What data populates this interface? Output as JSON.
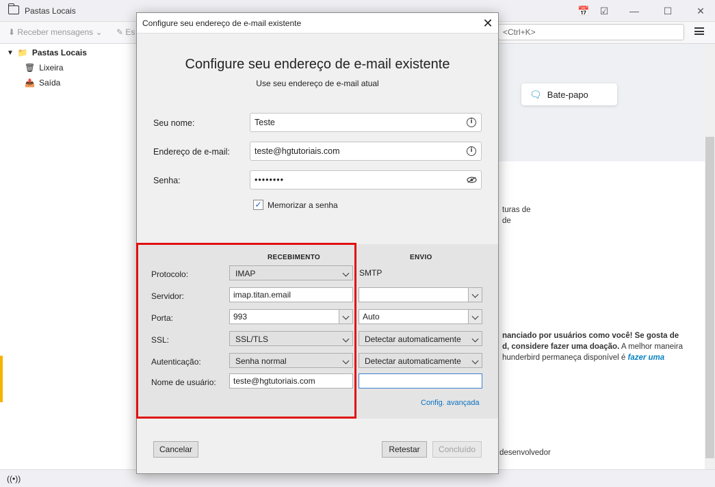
{
  "app": {
    "title": "Pastas Locais",
    "toolbar": {
      "receive_label": "Receber mensagens",
      "write_label": "Es"
    },
    "search_placeholder": "<Ctrl+K>",
    "folders": [
      {
        "label": "Pastas Locais",
        "icon": "folder-icon"
      },
      {
        "label": "Lixeira",
        "icon": "trash-icon"
      },
      {
        "label": "Saída",
        "icon": "outbox-icon"
      }
    ],
    "chat_card_label": "Bate-papo",
    "background_text": {
      "line1": "turas de",
      "line2": "de",
      "donation_bold": "nanciado por usuários como você! Se gosta de",
      "donation_bold2": "d, considere fazer uma doação.",
      "donation_rest": " A melhor maneira",
      "donation_line3": "hunderbird permaneça disponível é ",
      "donation_link": "fazer uma",
      "developer": "desenvolvedor"
    }
  },
  "dialog": {
    "window_title": "Configure seu endereço de e-mail existente",
    "heading": "Configure seu endereço de e-mail existente",
    "subheading": "Use seu endereço de e-mail atual",
    "fields": {
      "name_label": "Seu nome:",
      "name_value": "Teste",
      "email_label": "Endereço de e-mail:",
      "email_value": "teste@hgtutoriais.com",
      "password_label": "Senha:",
      "password_value": "••••••••"
    },
    "remember_label": "Memorizar a senha",
    "remember_checked": true,
    "server": {
      "incoming_header": "RECEBIMENTO",
      "outgoing_header": "ENVIO",
      "labels": {
        "protocol": "Protocolo:",
        "server": "Servidor:",
        "port": "Porta:",
        "ssl": "SSL:",
        "auth": "Autenticação:",
        "username": "Nome de usuário:"
      },
      "incoming": {
        "protocol": "IMAP",
        "server": "imap.titan.email",
        "port": "993",
        "ssl": "SSL/TLS",
        "auth": "Senha normal",
        "username": "teste@hgtutoriais.com"
      },
      "outgoing": {
        "protocol": "SMTP",
        "server": "",
        "port": "Auto",
        "ssl": "Detectar automaticamente",
        "auth": "Detectar automaticamente",
        "username": ""
      },
      "advanced_link": "Config. avançada"
    },
    "buttons": {
      "cancel": "Cancelar",
      "retest": "Retestar",
      "done": "Concluído"
    }
  },
  "colors": {
    "highlight_box": "#e01010",
    "link": "#0a70c0"
  }
}
